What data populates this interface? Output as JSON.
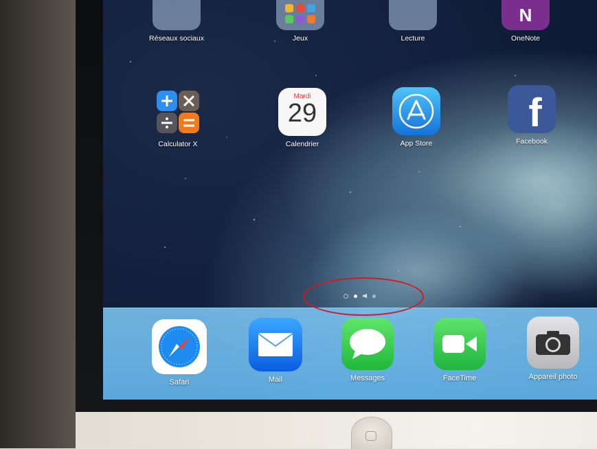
{
  "home_screen": {
    "top_row": [
      {
        "label": "Réseaux sociaux",
        "icon": "social-networks-folder-icon"
      },
      {
        "label": "Jeux",
        "icon": "games-folder-icon"
      },
      {
        "label": "Lecture",
        "icon": "reading-folder-icon"
      },
      {
        "label": "OneNote",
        "icon": "onenote-icon",
        "icon_text": "N"
      }
    ],
    "second_row": [
      {
        "label": "Calculator X",
        "icon": "calculator-icon"
      },
      {
        "label": "Calendrier",
        "icon": "calendar-icon",
        "day_name": "Mardi",
        "day_number": "29"
      },
      {
        "label": "App Store",
        "icon": "app-store-icon"
      },
      {
        "label": "Facebook",
        "icon": "facebook-icon",
        "icon_text": "f"
      }
    ],
    "page_indicator": {
      "pages": 3,
      "active_page": 1,
      "has_search_page": true,
      "has_audio_indicator": true
    },
    "dock": [
      {
        "label": "Safari",
        "icon": "safari-icon"
      },
      {
        "label": "Mail",
        "icon": "mail-icon"
      },
      {
        "label": "Messages",
        "icon": "messages-icon"
      },
      {
        "label": "FaceTime",
        "icon": "facetime-icon"
      },
      {
        "label": "Appareil photo",
        "icon": "camera-icon"
      }
    ]
  },
  "annotation": {
    "shape": "ellipse",
    "color": "#d3191f",
    "target": "page indicator dots"
  },
  "colors": {
    "dock": "#6fb9e6",
    "calendar_red": "#e2403a",
    "facebook_blue": "#3b5998",
    "onenote_purple": "#7a2e8e",
    "green_apps": "#2ec44f"
  }
}
